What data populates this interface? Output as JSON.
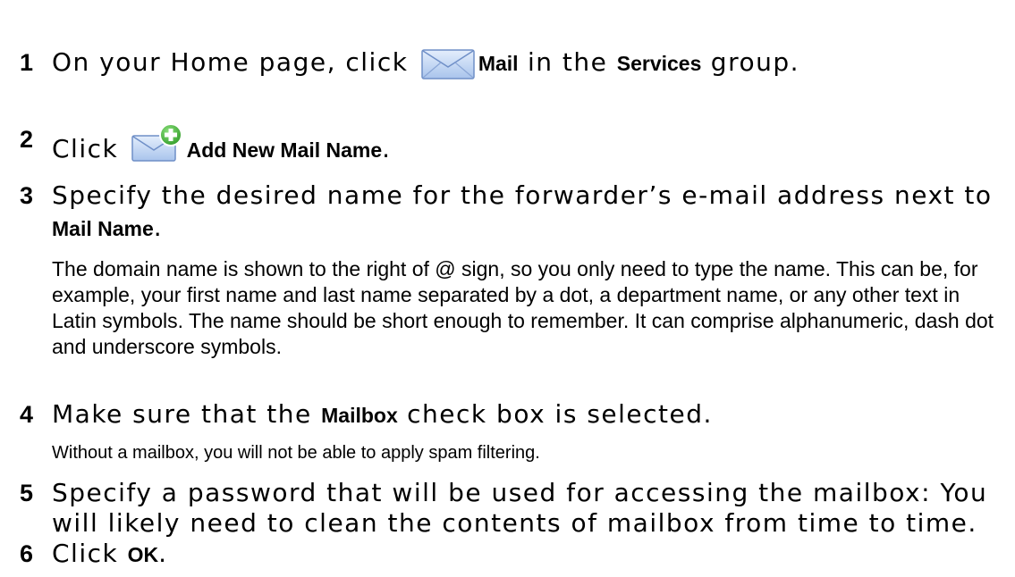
{
  "steps": [
    {
      "number": "1",
      "before": "On your Home page, click ",
      "icon": "mail-icon",
      "keyword": "Mail",
      "middle": " in the ",
      "keyword2": "Services",
      "after": " group."
    },
    {
      "number": "2",
      "before": "Click ",
      "icon": "add-mail-icon",
      "keyword": "Add New Mail Name",
      "after": "."
    },
    {
      "number": "3",
      "line1": "Specify the desired name for the forwarder’s e-mail address next to",
      "keyword": "Mail Name",
      "after": ".",
      "note": "The domain name is shown to the right of @ sign, so you only need to type the name. This can be, for example, your first name and last name separated by a dot, a department name, or any other text in Latin symbols. The name should be short enough to remember. It can comprise alphanumeric, dash dot and underscore symbols."
    },
    {
      "number": "4",
      "before": "Make sure that the ",
      "keyword": "Mailbox",
      "after": " check box is selected.",
      "note": "Without a mailbox, you will not be able to apply spam filtering."
    },
    {
      "number": "5",
      "line1": "Specify a password that will be used for accessing the mailbox: You",
      "line2": "will likely need to clean the contents of mailbox from time to time."
    },
    {
      "number": "6",
      "before": "Click ",
      "keyword": "OK",
      "after": "."
    }
  ],
  "colors": {
    "envelope_fill": "#c9dcf5",
    "envelope_stroke": "#6f8fc7",
    "plus_green": "#34a52c"
  }
}
